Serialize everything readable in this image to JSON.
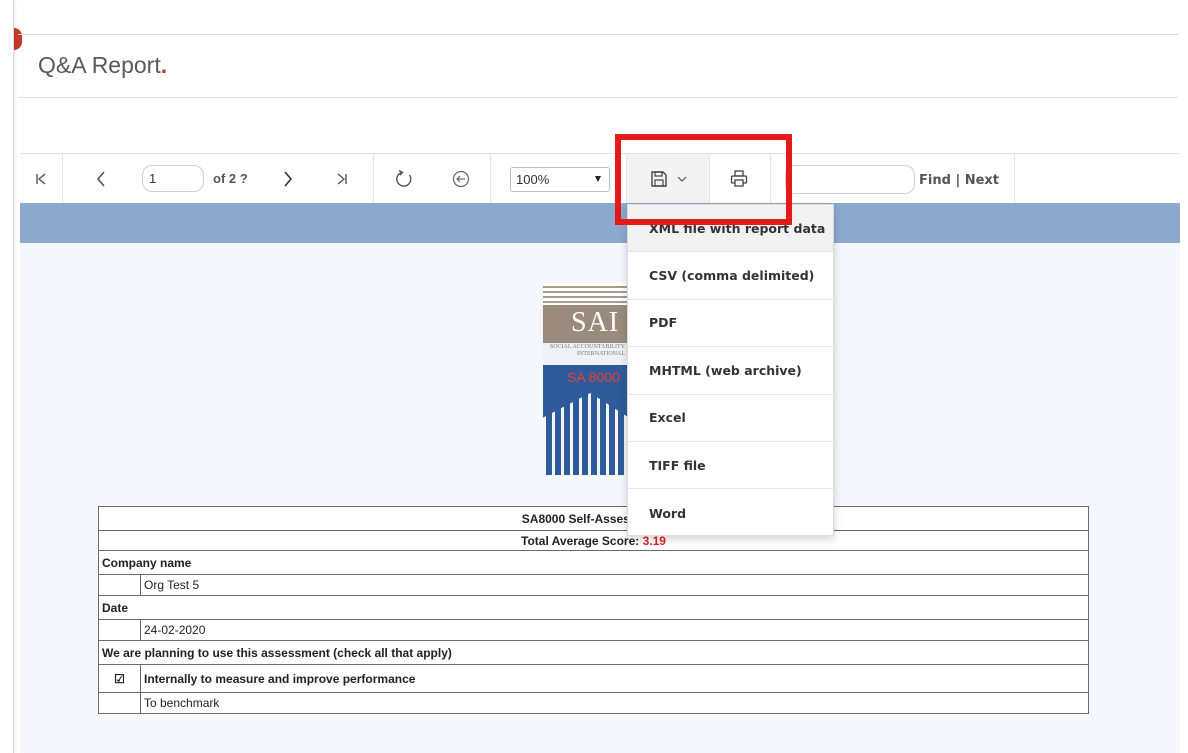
{
  "header": {
    "title": "Q&A Report",
    "title_dot": "."
  },
  "toolbar": {
    "page_value": "1",
    "page_of": "of 2 ?",
    "zoom_value": "100%",
    "find_label": "Find",
    "find_separator": "|",
    "next_label": "Next",
    "icons": [
      "first-page-icon",
      "prev-page-icon",
      "next-page-icon",
      "last-page-icon",
      "refresh-icon",
      "back-icon",
      "save-icon",
      "chevron-down-icon",
      "print-icon"
    ]
  },
  "export_menu": {
    "items": [
      {
        "label": "XML file with report data"
      },
      {
        "label": "CSV (comma delimited)"
      },
      {
        "label": "PDF"
      },
      {
        "label": "MHTML (web archive)"
      },
      {
        "label": "Excel"
      },
      {
        "label": "TIFF file"
      },
      {
        "label": "Word"
      }
    ]
  },
  "logo": {
    "main": "SAI",
    "tagline": "SOCIAL ACCOUNTABILITY INTERNATIONAL",
    "sub": "SA 8000"
  },
  "report": {
    "title": "SA8000 Self-Assessment",
    "score_label": "Total Average Score:",
    "score_value": "3.19",
    "company_label": "Company name",
    "company_value": "Org Test 5",
    "date_label": "Date",
    "date_value": "24-02-2020",
    "usage_label": "We are planning to use this assessment (check all that apply)",
    "usage_checkbox": "☑",
    "usage_option_1": "Internally to measure and improve performance",
    "usage_option_2": "To benchmark"
  },
  "colors": {
    "accent_red": "#e21a1a",
    "band_blue": "#8ba9cf",
    "title_blue": "#2e74b8",
    "score_red": "#e02020"
  }
}
